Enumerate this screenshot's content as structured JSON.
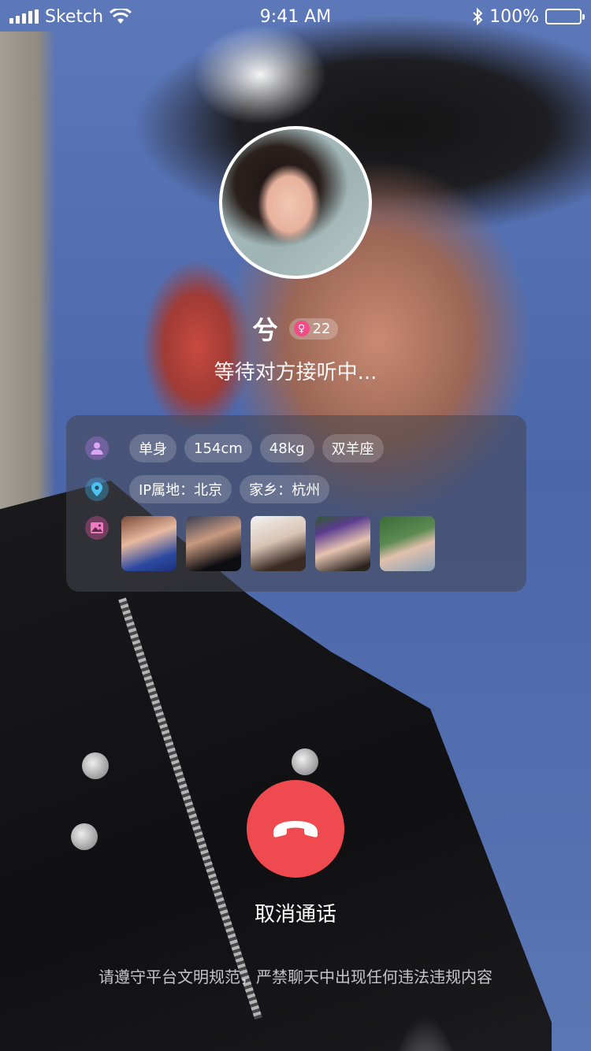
{
  "status_bar": {
    "carrier": "Sketch",
    "time": "9:41 AM",
    "battery_percent": "100%",
    "icons": [
      "signal-icon",
      "wifi-icon",
      "bluetooth-icon",
      "battery-icon"
    ]
  },
  "caller": {
    "name": "兮",
    "age": "22",
    "gender_icon": "female-icon",
    "status_text": "等待对方接听中..."
  },
  "profile": {
    "tags": [
      "单身",
      "154cm",
      "48kg",
      "双羊座"
    ],
    "location_tags": [
      "IP属地：北京",
      "家乡：杭州"
    ],
    "photo_count": 5,
    "row_icons": [
      "person-icon",
      "location-pin-icon",
      "photo-icon"
    ]
  },
  "actions": {
    "cancel_label": "取消通话",
    "cancel_icon": "hang-up-phone-icon"
  },
  "footer": {
    "notice": "请遵守平台文明规范，严禁聊天中出现任何违法违规内容"
  },
  "colors": {
    "hangup": "#ee4a4f",
    "female_badge": "#f24b86",
    "card_bg": "rgba(70,70,80,0.55)"
  }
}
